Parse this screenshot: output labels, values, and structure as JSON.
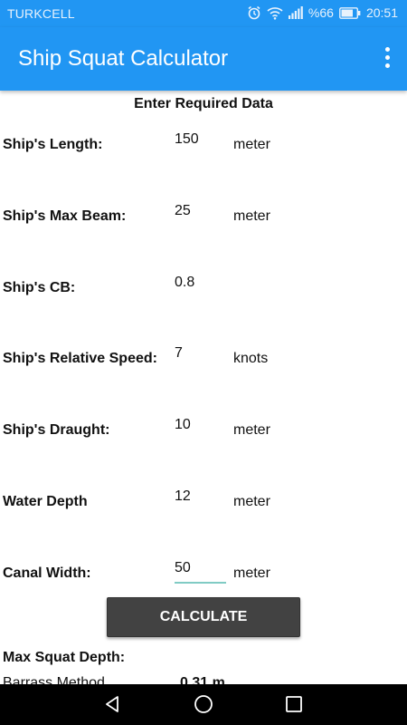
{
  "status_bar": {
    "carrier": "TURKCELL",
    "battery": "%66",
    "time": "20:51"
  },
  "app_bar": {
    "title": "Ship Squat Calculator"
  },
  "form": {
    "heading": "Enter Required Data",
    "fields": [
      {
        "label": "Ship's Length:",
        "value": "150",
        "unit": "meter"
      },
      {
        "label": "Ship's Max Beam:",
        "value": "25",
        "unit": "meter"
      },
      {
        "label": "Ship's CB:",
        "value": "0.8",
        "unit": ""
      },
      {
        "label": "Ship's Relative Speed:",
        "value": "7",
        "unit": "knots"
      },
      {
        "label": "Ship's Draught:",
        "value": "10",
        "unit": "meter"
      },
      {
        "label": "Water Depth",
        "value": "12",
        "unit": "meter"
      },
      {
        "label": "Canal Width:",
        "value": "50",
        "unit": "meter"
      }
    ]
  },
  "calculate_button": "CALCULATE",
  "results": {
    "heading": "Max Squat Depth:",
    "rows": [
      {
        "method": "Barrass Method",
        "value": "0.31 m"
      }
    ]
  }
}
